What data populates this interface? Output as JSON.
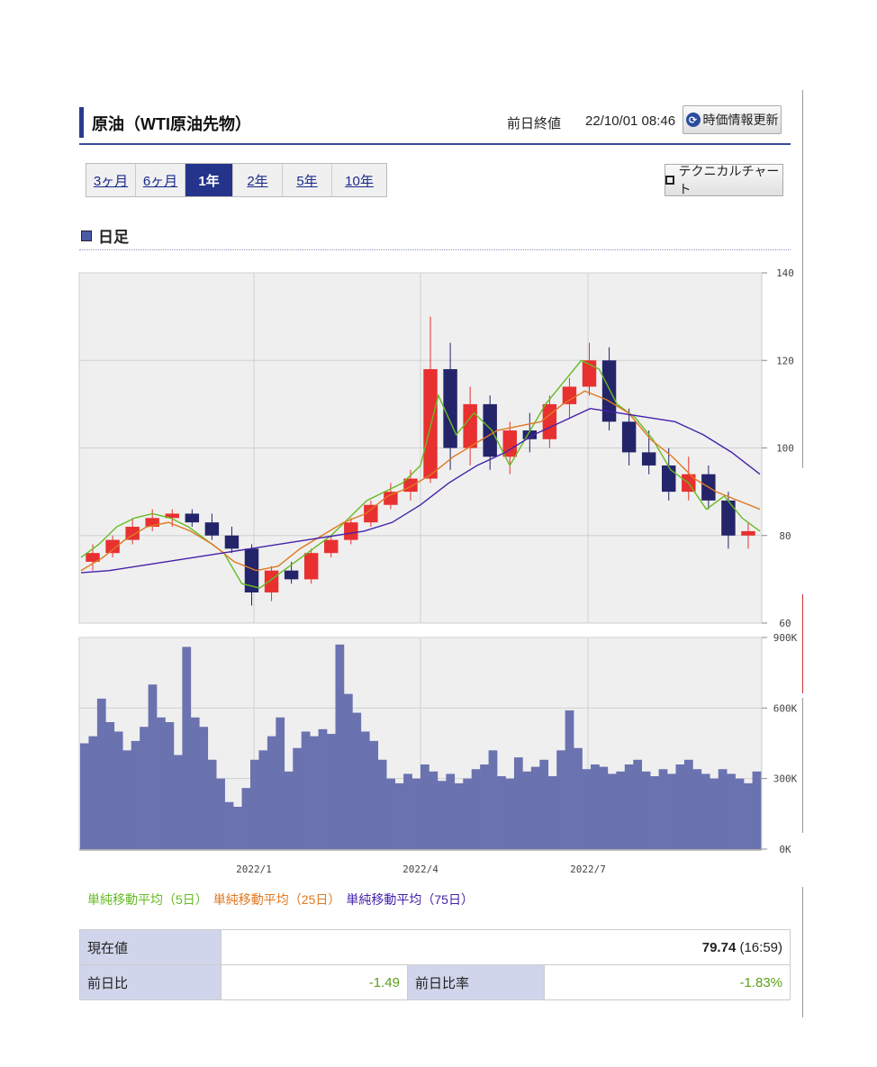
{
  "header": {
    "title": "原油（WTI原油先物）",
    "close_label": "前日終値",
    "datetime": "22/10/01 08:46",
    "refresh_button": "時価情報更新"
  },
  "tabs": [
    {
      "label": "3ヶ月",
      "active": false
    },
    {
      "label": "6ヶ月",
      "active": false
    },
    {
      "label": "1年",
      "active": true
    },
    {
      "label": "2年",
      "active": false
    },
    {
      "label": "5年",
      "active": false
    },
    {
      "label": "10年",
      "active": false
    }
  ],
  "tech_button": "テクニカルチャート",
  "section_title": "日足",
  "legend": [
    {
      "label": "単純移動平均（5日）",
      "color": "#66bb22"
    },
    {
      "label": "単純移動平均（25日）",
      "color": "#e07820"
    },
    {
      "label": "単純移動平均（75日）",
      "color": "#4422aa"
    }
  ],
  "chart_data": [
    {
      "type": "line",
      "ylim": [
        60,
        140
      ],
      "y_ticks": [
        "140",
        "120",
        "100",
        "80",
        "60"
      ],
      "x_ticks": [
        "2022/1",
        "2022/4",
        "2022/7"
      ],
      "grid": true,
      "colors": {
        "up": "#e83030",
        "down": "#24246a"
      },
      "series": [
        {
          "name": "単純移動平均（5日）",
          "color": "#66bb22",
          "values": [
            75,
            78,
            82,
            84,
            85,
            84,
            82,
            79,
            76,
            69,
            68,
            71,
            74,
            77,
            80,
            84,
            88,
            90,
            92,
            96,
            112,
            103,
            108,
            104,
            96,
            103,
            110,
            115,
            120,
            118,
            110,
            107,
            102,
            95,
            92,
            86,
            89,
            84,
            81
          ]
        },
        {
          "name": "単純移動平均（25日）",
          "color": "#e07820",
          "values": [
            72,
            75,
            79,
            82,
            83,
            81,
            78,
            74,
            72,
            73,
            77,
            80,
            83,
            85,
            89,
            91,
            94,
            98,
            101,
            104,
            105,
            106,
            110,
            113,
            111,
            108,
            102,
            98,
            93,
            90,
            88,
            86
          ]
        },
        {
          "name": "単純移動平均（75日）",
          "color": "#4422aa",
          "values": [
            71.5,
            72,
            73,
            74,
            75,
            76,
            77,
            78,
            79,
            80,
            81,
            83,
            87,
            92,
            96,
            99,
            103,
            106,
            109,
            108,
            107,
            106,
            103,
            99,
            94
          ]
        }
      ],
      "candles": [
        {
          "x": 0,
          "open": 74,
          "high": 78,
          "low": 72,
          "close": 76
        },
        {
          "x": 1,
          "open": 76,
          "high": 80,
          "low": 75,
          "close": 79
        },
        {
          "x": 2,
          "open": 79,
          "high": 84,
          "low": 78,
          "close": 82
        },
        {
          "x": 3,
          "open": 82,
          "high": 86,
          "low": 81,
          "close": 84
        },
        {
          "x": 4,
          "open": 84,
          "high": 86,
          "low": 82,
          "close": 85
        },
        {
          "x": 5,
          "open": 85,
          "high": 86,
          "low": 82,
          "close": 83
        },
        {
          "x": 6,
          "open": 83,
          "high": 85,
          "low": 79,
          "close": 80
        },
        {
          "x": 7,
          "open": 80,
          "high": 82,
          "low": 76,
          "close": 77
        },
        {
          "x": 8,
          "open": 77,
          "high": 78,
          "low": 64,
          "close": 67
        },
        {
          "x": 9,
          "open": 67,
          "high": 73,
          "low": 65,
          "close": 72
        },
        {
          "x": 10,
          "open": 72,
          "high": 74,
          "low": 69,
          "close": 70
        },
        {
          "x": 11,
          "open": 70,
          "high": 77,
          "low": 69,
          "close": 76
        },
        {
          "x": 12,
          "open": 76,
          "high": 80,
          "low": 75,
          "close": 79
        },
        {
          "x": 13,
          "open": 79,
          "high": 84,
          "low": 78,
          "close": 83
        },
        {
          "x": 14,
          "open": 83,
          "high": 88,
          "low": 82,
          "close": 87
        },
        {
          "x": 15,
          "open": 87,
          "high": 92,
          "low": 86,
          "close": 90
        },
        {
          "x": 16,
          "open": 90,
          "high": 95,
          "low": 88,
          "close": 93
        },
        {
          "x": 17,
          "open": 93,
          "high": 130,
          "low": 92,
          "close": 118
        },
        {
          "x": 18,
          "open": 118,
          "high": 124,
          "low": 95,
          "close": 100
        },
        {
          "x": 19,
          "open": 100,
          "high": 114,
          "low": 96,
          "close": 110
        },
        {
          "x": 20,
          "open": 110,
          "high": 112,
          "low": 95,
          "close": 98
        },
        {
          "x": 21,
          "open": 98,
          "high": 106,
          "low": 94,
          "close": 104
        },
        {
          "x": 22,
          "open": 104,
          "high": 108,
          "low": 99,
          "close": 102
        },
        {
          "x": 23,
          "open": 102,
          "high": 112,
          "low": 100,
          "close": 110
        },
        {
          "x": 24,
          "open": 110,
          "high": 116,
          "low": 107,
          "close": 114
        },
        {
          "x": 25,
          "open": 114,
          "high": 124,
          "low": 112,
          "close": 120
        },
        {
          "x": 26,
          "open": 120,
          "high": 123,
          "low": 104,
          "close": 106
        },
        {
          "x": 27,
          "open": 106,
          "high": 109,
          "low": 96,
          "close": 99
        },
        {
          "x": 28,
          "open": 99,
          "high": 104,
          "low": 94,
          "close": 96
        },
        {
          "x": 29,
          "open": 96,
          "high": 100,
          "low": 88,
          "close": 90
        },
        {
          "x": 30,
          "open": 90,
          "high": 98,
          "low": 88,
          "close": 94
        },
        {
          "x": 31,
          "open": 94,
          "high": 96,
          "low": 86,
          "close": 88
        },
        {
          "x": 32,
          "open": 88,
          "high": 90,
          "low": 77,
          "close": 80
        },
        {
          "x": 33,
          "open": 80,
          "high": 83,
          "low": 77,
          "close": 81
        }
      ]
    },
    {
      "type": "bar",
      "ylim": [
        0,
        900000
      ],
      "y_ticks": [
        "900K",
        "600K",
        "300K",
        "0K"
      ],
      "x_ticks": [
        "2022/1",
        "2022/4",
        "2022/7"
      ],
      "grid": true,
      "color": "#6a72b0",
      "values": [
        450000,
        480000,
        640000,
        540000,
        500000,
        420000,
        460000,
        520000,
        700000,
        560000,
        540000,
        400000,
        860000,
        560000,
        520000,
        380000,
        300000,
        200000,
        180000,
        260000,
        380000,
        420000,
        480000,
        560000,
        330000,
        430000,
        500000,
        480000,
        510000,
        490000,
        870000,
        660000,
        580000,
        500000,
        460000,
        380000,
        300000,
        280000,
        320000,
        300000,
        360000,
        330000,
        290000,
        320000,
        280000,
        300000,
        340000,
        360000,
        420000,
        310000,
        300000,
        390000,
        330000,
        350000,
        380000,
        310000,
        420000,
        590000,
        430000,
        340000,
        360000,
        350000,
        320000,
        330000,
        360000,
        380000,
        330000,
        310000,
        340000,
        320000,
        360000,
        380000,
        340000,
        320000,
        300000,
        340000,
        320000,
        300000,
        280000,
        330000
      ]
    }
  ],
  "quote": {
    "current_label": "現在値",
    "current_value": "79.74",
    "current_time": "(16:59)",
    "change_label": "前日比",
    "change_value": "-1.49",
    "change_rate_label": "前日比率",
    "change_rate_value": "-1.83%"
  }
}
